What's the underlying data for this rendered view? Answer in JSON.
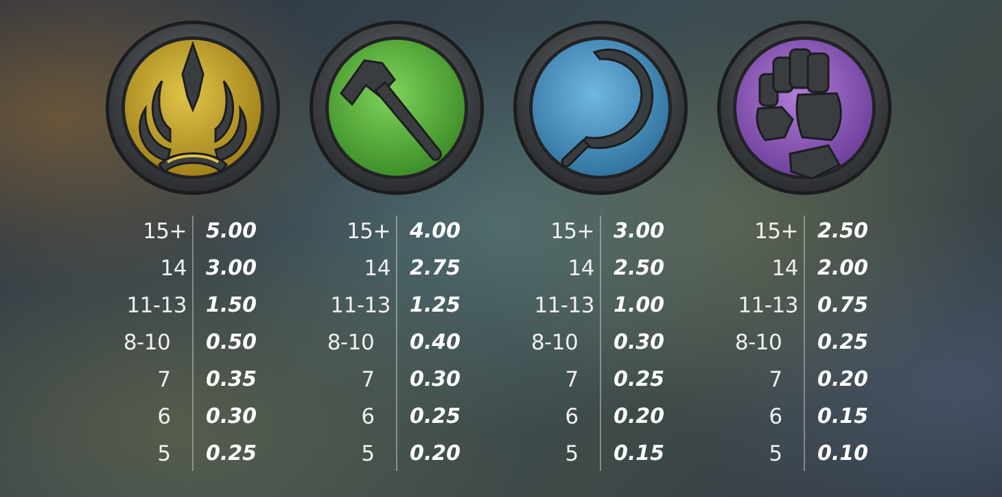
{
  "columns": [
    {
      "symbol": "crown-icon",
      "color": "#c9a82a",
      "rows": [
        {
          "count": "15+",
          "value": "5.00"
        },
        {
          "count": "14",
          "value": "3.00"
        },
        {
          "count": "11-13",
          "value": "1.50"
        },
        {
          "count": "8-10",
          "value": "0.50"
        },
        {
          "count": "7",
          "value": "0.35"
        },
        {
          "count": "6",
          "value": "0.30"
        },
        {
          "count": "5",
          "value": "0.25"
        }
      ]
    },
    {
      "symbol": "hammer-icon",
      "color": "#5fae3c",
      "rows": [
        {
          "count": "15+",
          "value": "4.00"
        },
        {
          "count": "14",
          "value": "2.75"
        },
        {
          "count": "11-13",
          "value": "1.25"
        },
        {
          "count": "8-10",
          "value": "0.40"
        },
        {
          "count": "7",
          "value": "0.30"
        },
        {
          "count": "6",
          "value": "0.25"
        },
        {
          "count": "5",
          "value": "0.20"
        }
      ]
    },
    {
      "symbol": "sickle-icon",
      "color": "#3f8fc0",
      "rows": [
        {
          "count": "15+",
          "value": "3.00"
        },
        {
          "count": "14",
          "value": "2.50"
        },
        {
          "count": "11-13",
          "value": "1.00"
        },
        {
          "count": "8-10",
          "value": "0.30"
        },
        {
          "count": "7",
          "value": "0.25"
        },
        {
          "count": "6",
          "value": "0.20"
        },
        {
          "count": "5",
          "value": "0.15"
        }
      ]
    },
    {
      "symbol": "fist-icon",
      "color": "#8a5bb8",
      "rows": [
        {
          "count": "15+",
          "value": "2.50"
        },
        {
          "count": "14",
          "value": "2.00"
        },
        {
          "count": "11-13",
          "value": "0.75"
        },
        {
          "count": "8-10",
          "value": "0.25"
        },
        {
          "count": "7",
          "value": "0.20"
        },
        {
          "count": "6",
          "value": "0.15"
        },
        {
          "count": "5",
          "value": "0.10"
        }
      ]
    }
  ]
}
